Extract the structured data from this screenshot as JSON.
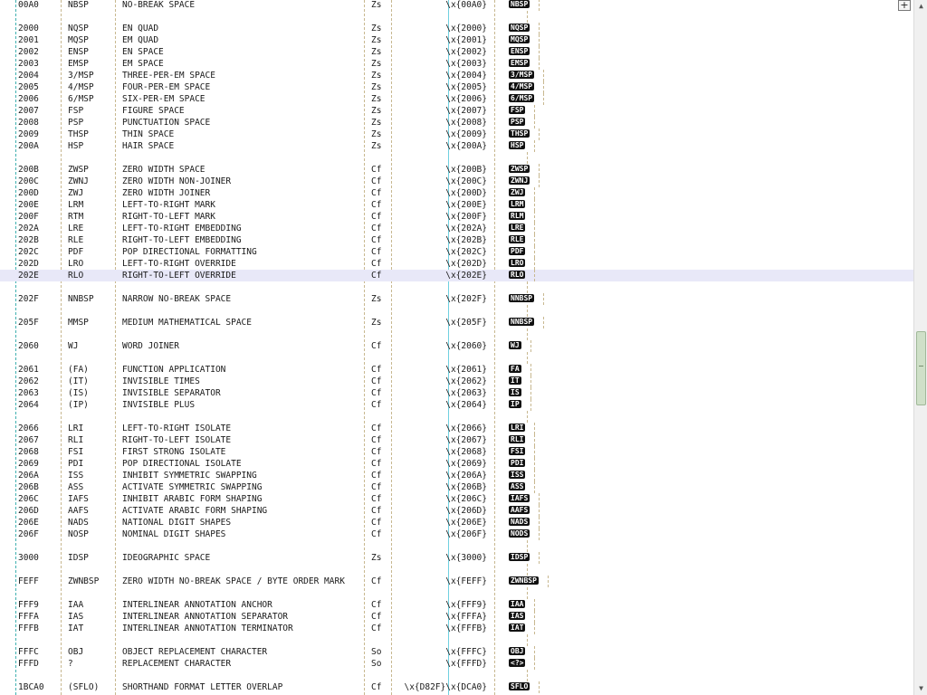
{
  "expand_button_label": "+",
  "colors": {
    "highlight_row": "#e8e8f8",
    "badge_bg": "#111111",
    "badge_fg": "#ffffff"
  },
  "rows": [
    {
      "code": "00A0",
      "abbr": "NBSP",
      "name": "NO-BREAK SPACE",
      "cat": "Zs",
      "esc": "\\x{00A0}",
      "badge": "NBSP"
    },
    {
      "blank": true
    },
    {
      "code": "2000",
      "abbr": "NQSP",
      "name": "EN QUAD",
      "cat": "Zs",
      "esc": "\\x{2000}",
      "badge": "NQSP"
    },
    {
      "code": "2001",
      "abbr": "MQSP",
      "name": "EM QUAD",
      "cat": "Zs",
      "esc": "\\x{2001}",
      "badge": "MQSP"
    },
    {
      "code": "2002",
      "abbr": "ENSP",
      "name": "EN SPACE",
      "cat": "Zs",
      "esc": "\\x{2002}",
      "badge": "ENSP"
    },
    {
      "code": "2003",
      "abbr": "EMSP",
      "name": "EM SPACE",
      "cat": "Zs",
      "esc": "\\x{2003}",
      "badge": "EMSP"
    },
    {
      "code": "2004",
      "abbr": "3/MSP",
      "name": "THREE-PER-EM SPACE",
      "cat": "Zs",
      "esc": "\\x{2004}",
      "badge": "3/MSP"
    },
    {
      "code": "2005",
      "abbr": "4/MSP",
      "name": "FOUR-PER-EM SPACE",
      "cat": "Zs",
      "esc": "\\x{2005}",
      "badge": "4/MSP"
    },
    {
      "code": "2006",
      "abbr": "6/MSP",
      "name": "SIX-PER-EM SPACE",
      "cat": "Zs",
      "esc": "\\x{2006}",
      "badge": "6/MSP"
    },
    {
      "code": "2007",
      "abbr": "FSP",
      "name": "FIGURE SPACE",
      "cat": "Zs",
      "esc": "\\x{2007}",
      "badge": "FSP"
    },
    {
      "code": "2008",
      "abbr": "PSP",
      "name": "PUNCTUATION SPACE",
      "cat": "Zs",
      "esc": "\\x{2008}",
      "badge": "PSP"
    },
    {
      "code": "2009",
      "abbr": "THSP",
      "name": "THIN SPACE",
      "cat": "Zs",
      "esc": "\\x{2009}",
      "badge": "THSP"
    },
    {
      "code": "200A",
      "abbr": "HSP",
      "name": "HAIR SPACE",
      "cat": "Zs",
      "esc": "\\x{200A}",
      "badge": "HSP"
    },
    {
      "blank": true
    },
    {
      "code": "200B",
      "abbr": "ZWSP",
      "name": "ZERO WIDTH SPACE",
      "cat": "Cf",
      "esc": "\\x{200B}",
      "badge": "ZWSP"
    },
    {
      "code": "200C",
      "abbr": "ZWNJ",
      "name": "ZERO WIDTH NON-JOINER",
      "cat": "Cf",
      "esc": "\\x{200C}",
      "badge": "ZWNJ"
    },
    {
      "code": "200D",
      "abbr": "ZWJ",
      "name": "ZERO WIDTH JOINER",
      "cat": "Cf",
      "esc": "\\x{200D}",
      "badge": "ZWJ"
    },
    {
      "code": "200E",
      "abbr": "LRM",
      "name": "LEFT-TO-RIGHT MARK",
      "cat": "Cf",
      "esc": "\\x{200E}",
      "badge": "LRM"
    },
    {
      "code": "200F",
      "abbr": "RTM",
      "name": "RIGHT-TO-LEFT MARK",
      "cat": "Cf",
      "esc": "\\x{200F}",
      "badge": "RLM"
    },
    {
      "code": "202A",
      "abbr": "LRE",
      "name": "LEFT-TO-RIGHT EMBEDDING",
      "cat": "Cf",
      "esc": "\\x{202A}",
      "badge": "LRE"
    },
    {
      "code": "202B",
      "abbr": "RLE",
      "name": "RIGHT-TO-LEFT EMBEDDING",
      "cat": "Cf",
      "esc": "\\x{202B}",
      "badge": "RLE"
    },
    {
      "code": "202C",
      "abbr": "PDF",
      "name": "POP DIRECTIONAL FORMATTING",
      "cat": "Cf",
      "esc": "\\x{202C}",
      "badge": "PDF"
    },
    {
      "code": "202D",
      "abbr": "LRO",
      "name": "LEFT-TO-RIGHT OVERRIDE",
      "cat": "Cf",
      "esc": "\\x{202D}",
      "badge": "LRO"
    },
    {
      "code": "202E",
      "abbr": "RLO",
      "name": "RIGHT-TO-LEFT OVERRIDE",
      "cat": "Cf",
      "esc": "\\x{202E}",
      "badge": "RLO",
      "highlight": true
    },
    {
      "blank": true
    },
    {
      "code": "202F",
      "abbr": "NNBSP",
      "name": "NARROW NO-BREAK SPACE",
      "cat": "Zs",
      "esc": "\\x{202F}",
      "badge": "NNBSP"
    },
    {
      "blank": true
    },
    {
      "code": "205F",
      "abbr": "MMSP",
      "name": "MEDIUM MATHEMATICAL SPACE",
      "cat": "Zs",
      "esc": "\\x{205F}",
      "badge": "NNBSP"
    },
    {
      "blank": true
    },
    {
      "code": "2060",
      "abbr": "WJ",
      "name": "WORD JOINER",
      "cat": "Cf",
      "esc": "\\x{2060}",
      "badge": "WJ"
    },
    {
      "blank": true
    },
    {
      "code": "2061",
      "abbr": "(FA)",
      "name": "FUNCTION APPLICATION",
      "cat": "Cf",
      "esc": "\\x{2061}",
      "badge": "FA"
    },
    {
      "code": "2062",
      "abbr": "(IT)",
      "name": "INVISIBLE TIMES",
      "cat": "Cf",
      "esc": "\\x{2062}",
      "badge": "IT"
    },
    {
      "code": "2063",
      "abbr": "(IS)",
      "name": "INVISIBLE SEPARATOR",
      "cat": "Cf",
      "esc": "\\x{2063}",
      "badge": "IS"
    },
    {
      "code": "2064",
      "abbr": "(IP)",
      "name": "INVISIBLE PLUS",
      "cat": "Cf",
      "esc": "\\x{2064}",
      "badge": "IP"
    },
    {
      "blank": true
    },
    {
      "code": "2066",
      "abbr": "LRI",
      "name": "LEFT-TO-RIGHT ISOLATE",
      "cat": "Cf",
      "esc": "\\x{2066}",
      "badge": "LRI"
    },
    {
      "code": "2067",
      "abbr": "RLI",
      "name": "RIGHT-TO-LEFT ISOLATE",
      "cat": "Cf",
      "esc": "\\x{2067}",
      "badge": "RLI"
    },
    {
      "code": "2068",
      "abbr": "FSI",
      "name": "FIRST STRONG ISOLATE",
      "cat": "Cf",
      "esc": "\\x{2068}",
      "badge": "FSI"
    },
    {
      "code": "2069",
      "abbr": "PDI",
      "name": "POP DIRECTIONAL ISOLATE",
      "cat": "Cf",
      "esc": "\\x{2069}",
      "badge": "PDI"
    },
    {
      "code": "206A",
      "abbr": "ISS",
      "name": "INHIBIT SYMMETRIC SWAPPING",
      "cat": "Cf",
      "esc": "\\x{206A}",
      "badge": "ISS"
    },
    {
      "code": "206B",
      "abbr": "ASS",
      "name": "ACTIVATE SYMMETRIC SWAPPING",
      "cat": "Cf",
      "esc": "\\x{206B}",
      "badge": "ASS"
    },
    {
      "code": "206C",
      "abbr": "IAFS",
      "name": "INHIBIT ARABIC FORM SHAPING",
      "cat": "Cf",
      "esc": "\\x{206C}",
      "badge": "IAFS"
    },
    {
      "code": "206D",
      "abbr": "AAFS",
      "name": "ACTIVATE ARABIC FORM SHAPING",
      "cat": "Cf",
      "esc": "\\x{206D}",
      "badge": "AAFS"
    },
    {
      "code": "206E",
      "abbr": "NADS",
      "name": "NATIONAL DIGIT SHAPES",
      "cat": "Cf",
      "esc": "\\x{206E}",
      "badge": "NADS"
    },
    {
      "code": "206F",
      "abbr": "NOSP",
      "name": "NOMINAL DIGIT SHAPES",
      "cat": "Cf",
      "esc": "\\x{206F}",
      "badge": "NODS"
    },
    {
      "blank": true
    },
    {
      "code": "3000",
      "abbr": "IDSP",
      "name": "IDEOGRAPHIC SPACE",
      "cat": "Zs",
      "esc": "\\x{3000}",
      "badge": "IDSP"
    },
    {
      "blank": true
    },
    {
      "code": "FEFF",
      "abbr": "ZWNBSP",
      "name": "ZERO WIDTH NO-BREAK SPACE / BYTE ORDER MARK",
      "cat": "Cf",
      "esc": "\\x{FEFF}",
      "badge": "ZWNBSP"
    },
    {
      "blank": true
    },
    {
      "code": "FFF9",
      "abbr": "IAA",
      "name": "INTERLINEAR ANNOTATION ANCHOR",
      "cat": "Cf",
      "esc": "\\x{FFF9}",
      "badge": "IAA"
    },
    {
      "code": "FFFA",
      "abbr": "IAS",
      "name": "INTERLINEAR ANNOTATION SEPARATOR",
      "cat": "Cf",
      "esc": "\\x{FFFA}",
      "badge": "IAS"
    },
    {
      "code": "FFFB",
      "abbr": "IAT",
      "name": "INTERLINEAR ANNOTATION TERMINATOR",
      "cat": "Cf",
      "esc": "\\x{FFFB}",
      "badge": "IAT"
    },
    {
      "blank": true
    },
    {
      "code": "FFFC",
      "abbr": "OBJ",
      "name": "OBJECT REPLACEMENT CHARACTER",
      "cat": "So",
      "esc": "\\x{FFFC}",
      "badge": "OBJ"
    },
    {
      "code": "FFFD",
      "abbr": "?",
      "name": "REPLACEMENT CHARACTER",
      "cat": "So",
      "esc": "\\x{FFFD}",
      "badge": "<?>"
    },
    {
      "blank": true
    },
    {
      "code": "1BCA0",
      "abbr": "(SFLO)",
      "name": "SHORTHAND FORMAT LETTER OVERLAP",
      "cat": "Cf",
      "esc": "\\x{D82F}\\x{DCA0}",
      "badge": "SFLO"
    }
  ]
}
